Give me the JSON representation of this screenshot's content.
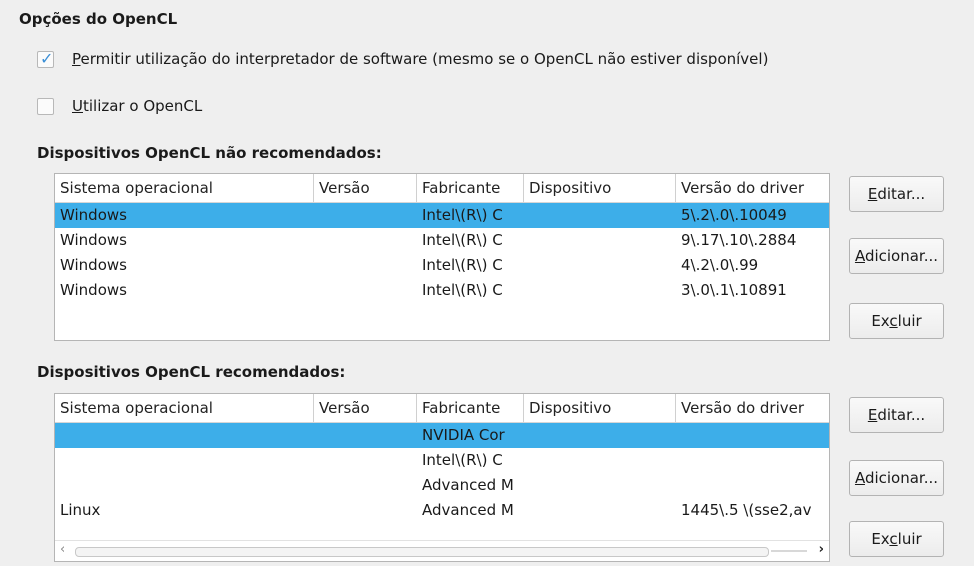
{
  "header": {
    "title": "Opções do OpenCL"
  },
  "options": {
    "allow_software": {
      "label_first": "P",
      "label_rest": "ermitir utilização do interpretador de software (mesmo se o OpenCL não estiver disponível)",
      "checked": true
    },
    "use_opencl": {
      "label_first": "U",
      "label_rest": "tilizar o OpenCL",
      "checked": false
    }
  },
  "blacklist": {
    "title": "Dispositivos OpenCL não recomendados:",
    "columns": [
      "Sistema operacional",
      "Versão",
      "Fabricante",
      "Dispositivo",
      "Versão do driver"
    ],
    "rows": [
      [
        "Windows",
        "",
        "Intel\\(R\\) C",
        "",
        "5\\.2\\.0\\.10049"
      ],
      [
        "Windows",
        "",
        "Intel\\(R\\) C",
        "",
        "9\\.17\\.10\\.2884"
      ],
      [
        "Windows",
        "",
        "Intel\\(R\\) C",
        "",
        "4\\.2\\.0\\.99"
      ],
      [
        "Windows",
        "",
        "Intel\\(R\\) C",
        "",
        "3\\.0\\.1\\.10891"
      ]
    ],
    "selected_row": 0,
    "buttons": {
      "edit": {
        "pre": "",
        "mnemonic": "E",
        "post": "ditar..."
      },
      "add": {
        "pre": "",
        "mnemonic": "A",
        "post": "dicionar..."
      },
      "delete": {
        "pre": "Ex",
        "mnemonic": "c",
        "post": "luir"
      }
    }
  },
  "whitelist": {
    "title": "Dispositivos OpenCL recomendados:",
    "columns": [
      "Sistema operacional",
      "Versão",
      "Fabricante",
      "Dispositivo",
      "Versão do driver"
    ],
    "rows": [
      [
        "",
        "",
        "NVIDIA Cor",
        "",
        ""
      ],
      [
        "",
        "",
        "Intel\\(R\\) C",
        "",
        ""
      ],
      [
        "",
        "",
        "Advanced M",
        "",
        ""
      ],
      [
        "Linux",
        "",
        "Advanced M",
        "",
        "1445\\.5 \\(sse2,av"
      ]
    ],
    "selected_row": 0,
    "buttons": {
      "edit": {
        "pre": "",
        "mnemonic": "E",
        "post": "ditar..."
      },
      "add": {
        "pre": "",
        "mnemonic": "A",
        "post": "dicionar..."
      },
      "delete": {
        "pre": "Ex",
        "mnemonic": "c",
        "post": "luir"
      }
    }
  },
  "colors": {
    "selection": "#3daee9",
    "check": "#3b8fd6"
  }
}
